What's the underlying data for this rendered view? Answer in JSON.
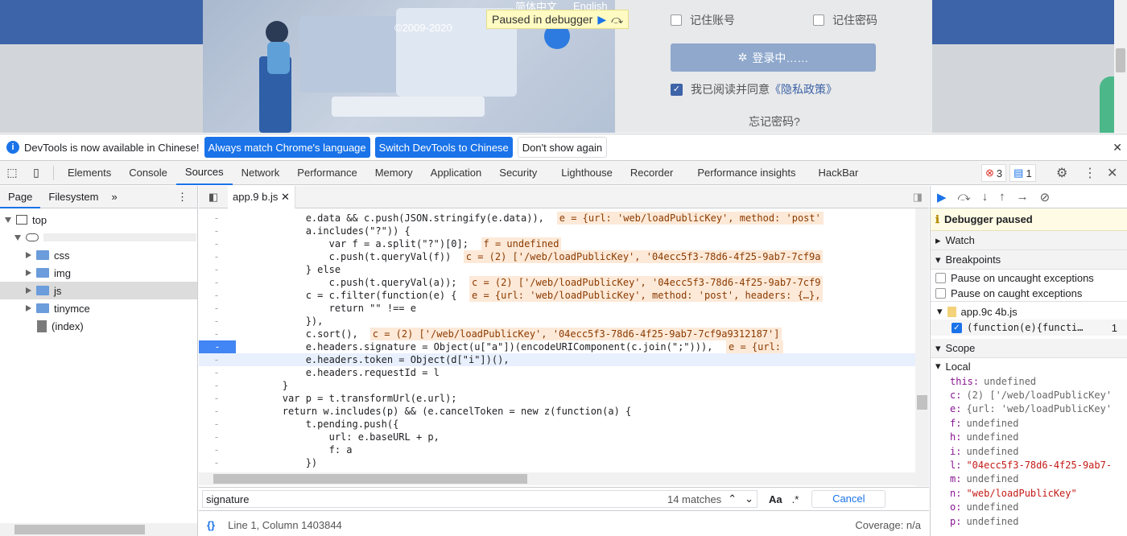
{
  "page": {
    "copyright": "©2009-2020",
    "lang_links": [
      "简体中文",
      "English"
    ],
    "paused_label": "Paused in debugger",
    "remember_account": "记住账号",
    "remember_password": "记住密码",
    "login_button": "登录中……",
    "agree_text": "我已阅读并同意",
    "privacy_link": "《隐私政策》",
    "forgot": "忘记密码?"
  },
  "banner": {
    "message": "DevTools is now available in Chinese!",
    "btn_match": "Always match Chrome's language",
    "btn_switch": "Switch DevTools to Chinese",
    "btn_dont": "Don't show again"
  },
  "tabs": [
    "Elements",
    "Console",
    "Sources",
    "Network",
    "Performance",
    "Memory",
    "Application",
    "Security",
    "Lighthouse",
    "Recorder",
    "Performance insights",
    "HackBar"
  ],
  "active_tab": "Sources",
  "badges": {
    "errors": "3",
    "messages": "1"
  },
  "nav": {
    "tab_page": "Page",
    "tab_filesystem": "Filesystem",
    "more": "»",
    "tree": {
      "top": "top",
      "css": "css",
      "img": "img",
      "js": "js",
      "tinymce": "tinymce",
      "index": "(index)"
    }
  },
  "editor": {
    "file_tab": "app.9         b.js",
    "status": "Line 1, Column 1403844",
    "coverage": "Coverage: n/a",
    "search": {
      "query": "signature",
      "matches": "14 matches",
      "match_case": "Aa",
      "regex": ".*",
      "cancel": "Cancel"
    }
  },
  "code_lines": [
    {
      "t": "            e.data && c.push(JSON.stringify(e.data)),",
      "v": "e = {url: 'web/loadPublicKey', method: 'post'"
    },
    {
      "t": "            a.includes(\"?\")) {",
      "v": ""
    },
    {
      "t": "                var f = a.split(\"?\")[0];",
      "v": "f = undefined"
    },
    {
      "t": "                c.push(t.queryVal(f))",
      "v": "c = (2) ['/web/loadPublicKey', '04ecc5f3-78d6-4f25-9ab7-7cf9a"
    },
    {
      "t": "            } else",
      "v": ""
    },
    {
      "t": "                c.push(t.queryVal(a));",
      "v": "c = (2) ['/web/loadPublicKey', '04ecc5f3-78d6-4f25-9ab7-7cf9"
    },
    {
      "t": "            c = c.filter(function(e) {",
      "v": "e = {url: 'web/loadPublicKey', method: 'post', headers: {…},"
    },
    {
      "t": "                return \"\" !== e",
      "v": ""
    },
    {
      "t": "            }),",
      "v": ""
    },
    {
      "t": "            c.sort(),",
      "v": "c = (2) ['/web/loadPublicKey', '04ecc5f3-78d6-4f25-9ab7-7cf9a9312187']"
    },
    {
      "t": "            e.headers.signature = Object(u[\"a\"])(encodeURIComponent(c.join(\";\"))),",
      "v": "e = {url:"
    },
    {
      "t": "            e.headers.token = Object(d[\"i\"])(),",
      "v": ""
    },
    {
      "t": "            e.headers.requestId = l",
      "v": ""
    },
    {
      "t": "        }",
      "v": ""
    },
    {
      "t": "        var p = t.transformUrl(e.url);",
      "v": ""
    },
    {
      "t": "        return w.includes(p) && (e.cancelToken = new z(function(a) {",
      "v": ""
    },
    {
      "t": "            t.pending.push({",
      "v": ""
    },
    {
      "t": "                url: e.baseURL + p,",
      "v": ""
    },
    {
      "t": "                f: a",
      "v": ""
    },
    {
      "t": "            })",
      "v": ""
    }
  ],
  "sidebar": {
    "paused": "Debugger paused",
    "watch": "Watch",
    "breakpoints": "Breakpoints",
    "pause_uncaught": "Pause on uncaught exceptions",
    "pause_caught": "Pause on caught exceptions",
    "bp_file": "app.9c      4b.js",
    "bp_code": "(function(e){functi…",
    "bp_line": "1",
    "scope": "Scope",
    "local": "Local",
    "vars": [
      {
        "k": "this:",
        "v": "undefined",
        "s": false
      },
      {
        "k": "c:",
        "v": "(2) ['/web/loadPublicKey'",
        "s": false
      },
      {
        "k": "e:",
        "v": "{url: 'web/loadPublicKey'",
        "s": false
      },
      {
        "k": "f:",
        "v": "undefined",
        "s": false
      },
      {
        "k": "h:",
        "v": "undefined",
        "s": false
      },
      {
        "k": "i:",
        "v": "undefined",
        "s": false
      },
      {
        "k": "l:",
        "v": "\"04ecc5f3-78d6-4f25-9ab7-",
        "s": true
      },
      {
        "k": "m:",
        "v": "undefined",
        "s": false
      },
      {
        "k": "n:",
        "v": "\"web/loadPublicKey\"",
        "s": true
      },
      {
        "k": "o:",
        "v": "undefined",
        "s": false
      },
      {
        "k": "p:",
        "v": "undefined",
        "s": false
      }
    ]
  }
}
